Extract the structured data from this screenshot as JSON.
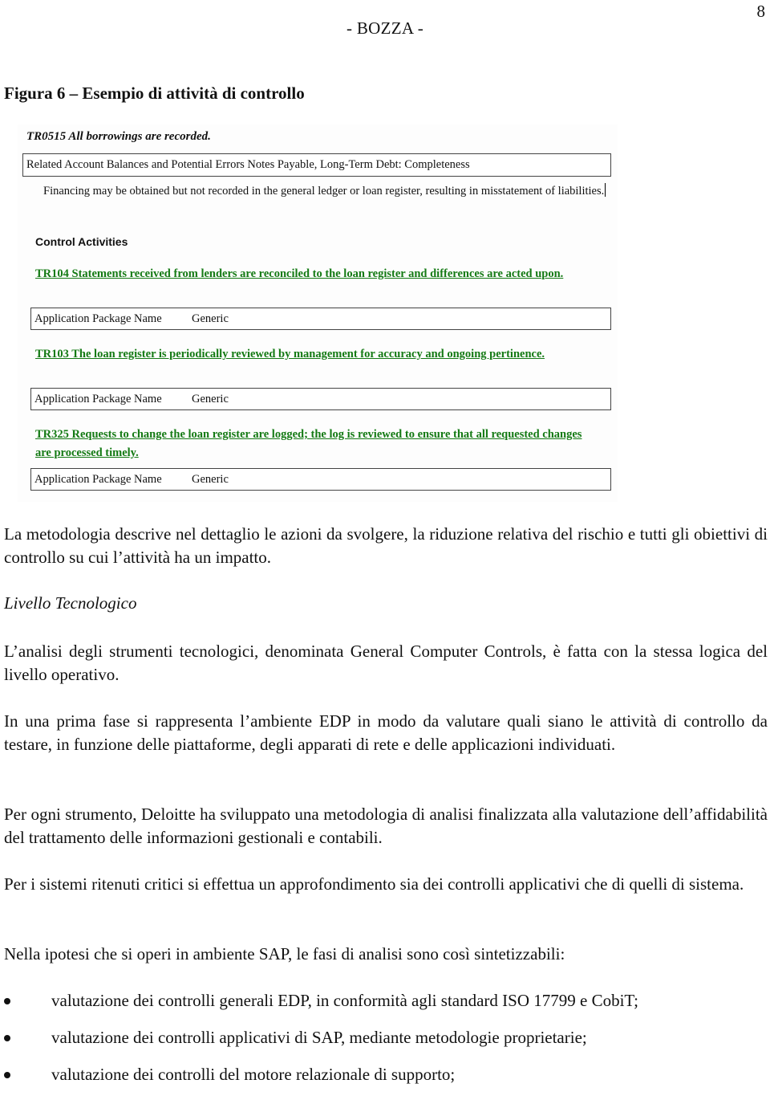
{
  "page": {
    "number": "8",
    "header": "- BOZZA -",
    "figure_title": "Figura 6 – Esempio di attività di controllo"
  },
  "figure": {
    "heading": "TR0515 All borrowings are recorded.",
    "related_box": "Related Account Balances and Potential Errors Notes Payable, Long-Term Debt: Completeness",
    "risk_text": "Financing may be obtained but not recorded in the general ledger or loan register, resulting in misstatement of liabilities.",
    "control_activities_heading": "Control Activities",
    "link_color": "#147a14",
    "controls": [
      {
        "title": "TR104 Statements received from lenders are reconciled to the loan register and differences are acted upon.",
        "package_label": "Application Package Name",
        "package_value": "Generic"
      },
      {
        "title": "TR103 The loan register is periodically reviewed by management for accuracy and ongoing pertinence.",
        "package_label": "Application Package Name",
        "package_value": "Generic"
      },
      {
        "title": "TR325 Requests to change the loan register are logged; the log is reviewed to ensure that all requested changes are processed timely.",
        "package_label": "Application Package Name",
        "package_value": "Generic"
      }
    ]
  },
  "body": {
    "p1": "La metodologia descrive nel dettaglio le azioni da svolgere, la riduzione relativa del rischio e tutti gli obiettivi di controllo su cui l’attività ha un impatto.",
    "section_title": "Livello Tecnologico",
    "p2": "L’analisi degli strumenti tecnologici, denominata General Computer Controls, è fatta con la stessa logica del livello operativo.",
    "p3": "In una prima fase si rappresenta l’ambiente EDP in modo da valutare quali siano le attività di controllo da testare, in funzione delle piattaforme, degli apparati di rete e delle applicazioni individuati.",
    "p4": "Per ogni strumento, Deloitte ha sviluppato una metodologia di analisi finalizzata alla valutazione dell’affidabilità del trattamento delle informazioni gestionali e contabili.",
    "p5": "Per i sistemi ritenuti critici si effettua un approfondimento sia dei controlli applicativi che di quelli di sistema.",
    "p6": "Nella ipotesi che si operi in ambiente SAP, le fasi di analisi sono così sintetizzabili:",
    "bullets": [
      "valutazione dei controlli generali EDP, in conformità agli standard ISO 17799 e CobiT;",
      "valutazione dei controlli applicativi di SAP, mediante metodologie proprietarie;",
      "valutazione dei controlli del motore relazionale di supporto;"
    ]
  }
}
